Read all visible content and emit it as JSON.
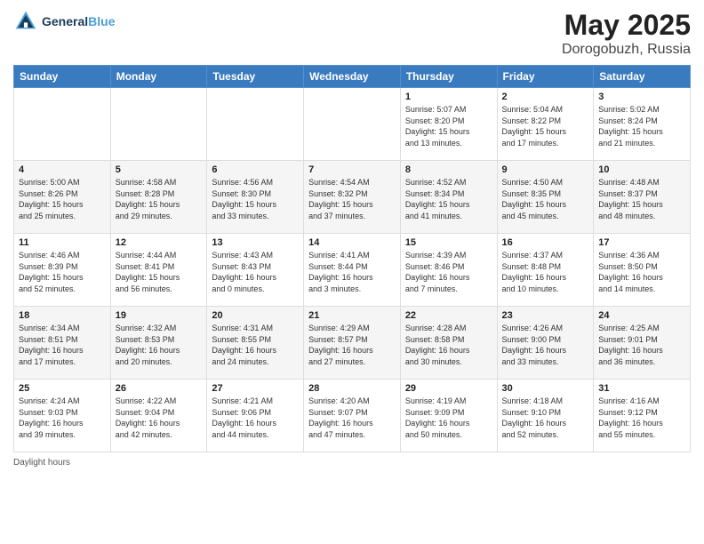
{
  "header": {
    "logo_line1": "General",
    "logo_line2": "Blue",
    "main_title": "May 2025",
    "subtitle": "Dorogobuzh, Russia"
  },
  "weekdays": [
    "Sunday",
    "Monday",
    "Tuesday",
    "Wednesday",
    "Thursday",
    "Friday",
    "Saturday"
  ],
  "weeks": [
    [
      {
        "day": "",
        "info": ""
      },
      {
        "day": "",
        "info": ""
      },
      {
        "day": "",
        "info": ""
      },
      {
        "day": "",
        "info": ""
      },
      {
        "day": "1",
        "info": "Sunrise: 5:07 AM\nSunset: 8:20 PM\nDaylight: 15 hours\nand 13 minutes."
      },
      {
        "day": "2",
        "info": "Sunrise: 5:04 AM\nSunset: 8:22 PM\nDaylight: 15 hours\nand 17 minutes."
      },
      {
        "day": "3",
        "info": "Sunrise: 5:02 AM\nSunset: 8:24 PM\nDaylight: 15 hours\nand 21 minutes."
      }
    ],
    [
      {
        "day": "4",
        "info": "Sunrise: 5:00 AM\nSunset: 8:26 PM\nDaylight: 15 hours\nand 25 minutes."
      },
      {
        "day": "5",
        "info": "Sunrise: 4:58 AM\nSunset: 8:28 PM\nDaylight: 15 hours\nand 29 minutes."
      },
      {
        "day": "6",
        "info": "Sunrise: 4:56 AM\nSunset: 8:30 PM\nDaylight: 15 hours\nand 33 minutes."
      },
      {
        "day": "7",
        "info": "Sunrise: 4:54 AM\nSunset: 8:32 PM\nDaylight: 15 hours\nand 37 minutes."
      },
      {
        "day": "8",
        "info": "Sunrise: 4:52 AM\nSunset: 8:34 PM\nDaylight: 15 hours\nand 41 minutes."
      },
      {
        "day": "9",
        "info": "Sunrise: 4:50 AM\nSunset: 8:35 PM\nDaylight: 15 hours\nand 45 minutes."
      },
      {
        "day": "10",
        "info": "Sunrise: 4:48 AM\nSunset: 8:37 PM\nDaylight: 15 hours\nand 48 minutes."
      }
    ],
    [
      {
        "day": "11",
        "info": "Sunrise: 4:46 AM\nSunset: 8:39 PM\nDaylight: 15 hours\nand 52 minutes."
      },
      {
        "day": "12",
        "info": "Sunrise: 4:44 AM\nSunset: 8:41 PM\nDaylight: 15 hours\nand 56 minutes."
      },
      {
        "day": "13",
        "info": "Sunrise: 4:43 AM\nSunset: 8:43 PM\nDaylight: 16 hours\nand 0 minutes."
      },
      {
        "day": "14",
        "info": "Sunrise: 4:41 AM\nSunset: 8:44 PM\nDaylight: 16 hours\nand 3 minutes."
      },
      {
        "day": "15",
        "info": "Sunrise: 4:39 AM\nSunset: 8:46 PM\nDaylight: 16 hours\nand 7 minutes."
      },
      {
        "day": "16",
        "info": "Sunrise: 4:37 AM\nSunset: 8:48 PM\nDaylight: 16 hours\nand 10 minutes."
      },
      {
        "day": "17",
        "info": "Sunrise: 4:36 AM\nSunset: 8:50 PM\nDaylight: 16 hours\nand 14 minutes."
      }
    ],
    [
      {
        "day": "18",
        "info": "Sunrise: 4:34 AM\nSunset: 8:51 PM\nDaylight: 16 hours\nand 17 minutes."
      },
      {
        "day": "19",
        "info": "Sunrise: 4:32 AM\nSunset: 8:53 PM\nDaylight: 16 hours\nand 20 minutes."
      },
      {
        "day": "20",
        "info": "Sunrise: 4:31 AM\nSunset: 8:55 PM\nDaylight: 16 hours\nand 24 minutes."
      },
      {
        "day": "21",
        "info": "Sunrise: 4:29 AM\nSunset: 8:57 PM\nDaylight: 16 hours\nand 27 minutes."
      },
      {
        "day": "22",
        "info": "Sunrise: 4:28 AM\nSunset: 8:58 PM\nDaylight: 16 hours\nand 30 minutes."
      },
      {
        "day": "23",
        "info": "Sunrise: 4:26 AM\nSunset: 9:00 PM\nDaylight: 16 hours\nand 33 minutes."
      },
      {
        "day": "24",
        "info": "Sunrise: 4:25 AM\nSunset: 9:01 PM\nDaylight: 16 hours\nand 36 minutes."
      }
    ],
    [
      {
        "day": "25",
        "info": "Sunrise: 4:24 AM\nSunset: 9:03 PM\nDaylight: 16 hours\nand 39 minutes."
      },
      {
        "day": "26",
        "info": "Sunrise: 4:22 AM\nSunset: 9:04 PM\nDaylight: 16 hours\nand 42 minutes."
      },
      {
        "day": "27",
        "info": "Sunrise: 4:21 AM\nSunset: 9:06 PM\nDaylight: 16 hours\nand 44 minutes."
      },
      {
        "day": "28",
        "info": "Sunrise: 4:20 AM\nSunset: 9:07 PM\nDaylight: 16 hours\nand 47 minutes."
      },
      {
        "day": "29",
        "info": "Sunrise: 4:19 AM\nSunset: 9:09 PM\nDaylight: 16 hours\nand 50 minutes."
      },
      {
        "day": "30",
        "info": "Sunrise: 4:18 AM\nSunset: 9:10 PM\nDaylight: 16 hours\nand 52 minutes."
      },
      {
        "day": "31",
        "info": "Sunrise: 4:16 AM\nSunset: 9:12 PM\nDaylight: 16 hours\nand 55 minutes."
      }
    ]
  ],
  "footer": {
    "daylight_label": "Daylight hours"
  }
}
